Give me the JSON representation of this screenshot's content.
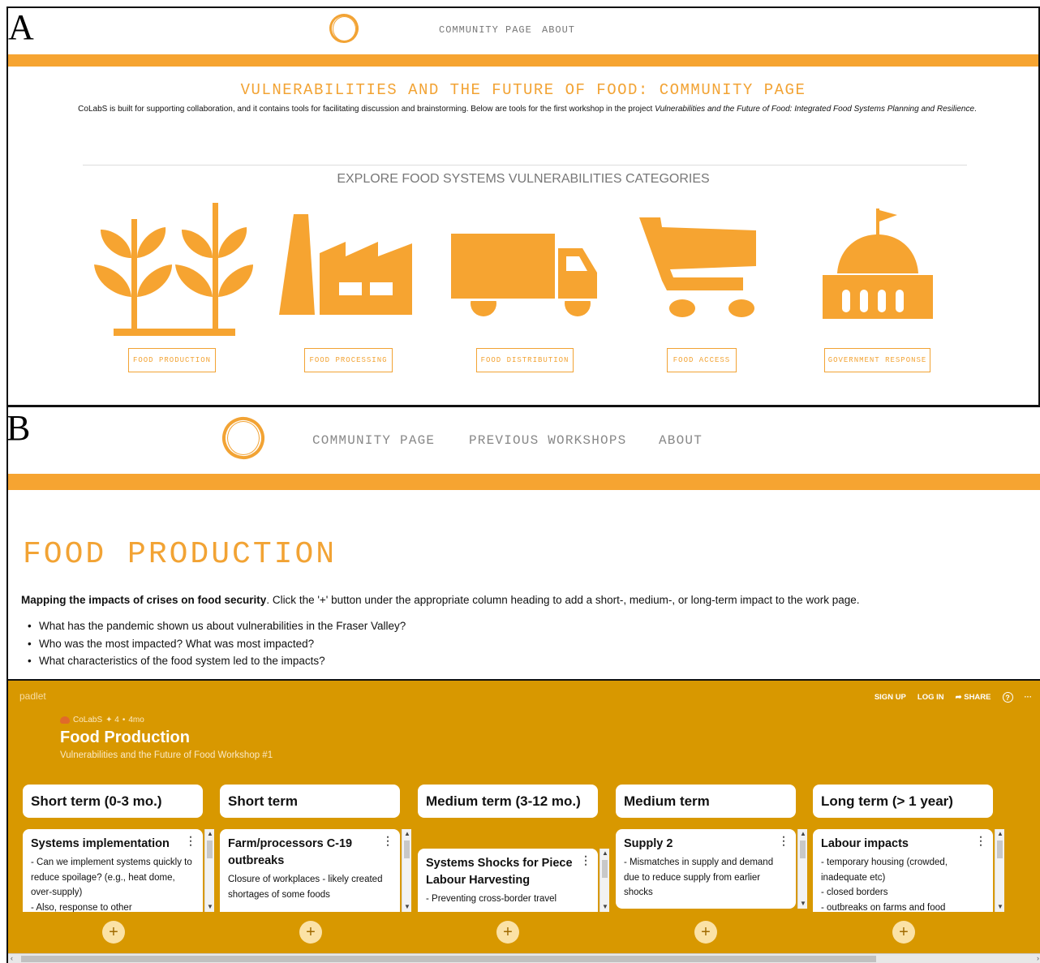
{
  "panel_a": {
    "label": "A",
    "nav": {
      "community": "COMMUNITY PAGE",
      "about": "ABOUT"
    },
    "title": "VULNERABILITIES AND THE FUTURE OF FOOD: COMMUNITY PAGE",
    "intro_plain": "CoLabS is built for supporting collaboration, and it contains tools for facilitating discussion and brainstorming. Below are tools for the first workshop in the project ",
    "intro_italic": "Vulnerabilities and the Future of Food: Integrated Food Systems Planning and Resilience",
    "intro_end": ".",
    "explore_heading": "EXPLORE FOOD SYSTEMS VULNERABILITIES CATEGORIES",
    "categories": [
      {
        "label": "FOOD PRODUCTION",
        "icon": "plants-icon"
      },
      {
        "label": "FOOD PROCESSING",
        "icon": "factory-icon"
      },
      {
        "label": "FOOD DISTRIBUTION",
        "icon": "truck-icon"
      },
      {
        "label": "FOOD ACCESS",
        "icon": "shopping-cart-icon"
      },
      {
        "label": "GOVERNMENT RESPONSE",
        "icon": "government-building-icon"
      }
    ],
    "accent_color": "#f6a431"
  },
  "panel_b": {
    "label": "B",
    "nav": {
      "community": "COMMUNITY PAGE",
      "previous": "PREVIOUS WORKSHOPS",
      "about": "ABOUT"
    },
    "title": "FOOD PRODUCTION",
    "intro_bold": "Mapping the impacts of crises on food security",
    "intro_rest": ". Click the '+' button under the appropriate column heading to add a short-, medium-, or long-term impact to the work page.",
    "questions": [
      "What has the pandemic shown us about vulnerabilities in the Fraser Valley?",
      "Who was the most impacted? What was most impacted?",
      "What characteristics of the food system led to the impacts?"
    ],
    "padlet": {
      "brand": "padlet",
      "actions": {
        "signup": "SIGN UP",
        "login": "LOG IN",
        "share": "SHARE",
        "help": "?",
        "more": "···"
      },
      "author": "CoLabS",
      "likes": "✦ 4",
      "sep": "•",
      "age": "4mo",
      "title": "Food Production",
      "subtitle": "Vulnerabilities and the Future of Food Workshop #1",
      "add_symbol": "+",
      "background_color": "#d89800",
      "columns": [
        {
          "heading": "Short term (0-3 mo.)",
          "card_title": "Systems implementation",
          "card_body": "- Can we implement systems quickly to reduce spoilage? (e.g., heat dome, over-supply)\n- Also, response to other"
        },
        {
          "heading": "Short term",
          "card_title": "Farm/processors C-19 outbreaks",
          "card_body": "Closure of workplaces - likely created shortages of some foods"
        },
        {
          "heading": "Medium term (3-12 mo.)",
          "card_title": "Systems Shocks for Piece Labour Harvesting",
          "card_body": "- Preventing cross-border travel"
        },
        {
          "heading": "Medium term",
          "card_title": "Supply 2",
          "card_body": "- Mismatches in supply and demand due to reduce supply from earlier shocks"
        },
        {
          "heading": "Long term (> 1 year)",
          "card_title": "Labour impacts",
          "card_body": "- temporary housing (crowded, inadequate etc)\n- closed borders\n- outbreaks on farms and food"
        }
      ]
    }
  }
}
